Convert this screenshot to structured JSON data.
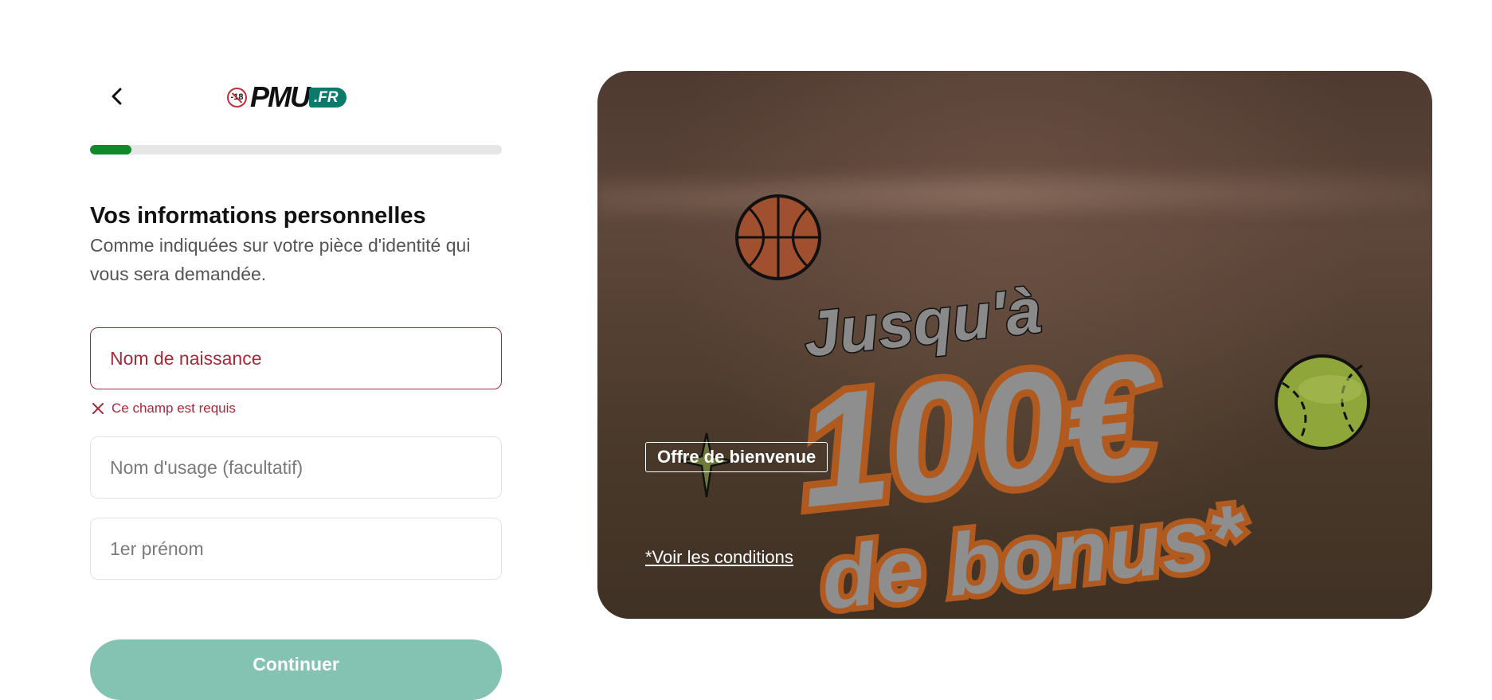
{
  "header": {
    "logo_text": "PMU",
    "logo_tld": ".FR",
    "age_badge": "-18"
  },
  "progress": {
    "fraction": 0.1
  },
  "form": {
    "title": "Vos informations personnelles",
    "subtitle": "Comme indiquées sur votre pièce d'identité qui vous sera demandée.",
    "fields": {
      "birth_name": {
        "placeholder": "Nom de naissance",
        "value": ""
      },
      "usage_name": {
        "placeholder": "Nom d'usage (facultatif)",
        "value": ""
      },
      "first_name": {
        "placeholder": "1er prénom",
        "value": ""
      }
    },
    "error_message": "Ce champ est requis",
    "continue_label": "Continuer"
  },
  "promo": {
    "tag": "Offre de bienvenue",
    "headline_line1": "Jusqu'à",
    "headline_amount": "100€",
    "headline_line3": "de bonus*",
    "conditions_link": "*Voir les conditions"
  },
  "colors": {
    "accent_green": "#0f8a2a",
    "error_red": "#a8283a",
    "brand_teal": "#0b7a6b",
    "button_disabled": "#84c3b2"
  }
}
